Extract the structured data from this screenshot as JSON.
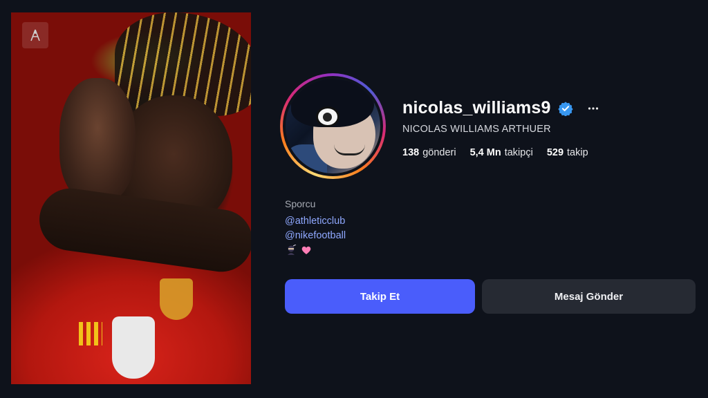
{
  "profile": {
    "username": "nicolas_williams9",
    "full_name": "NICOLAS WILLIAMS ARTHUER",
    "verified": true,
    "stats": {
      "posts_value": "138",
      "posts_label": "gönderi",
      "followers_value": "5,4 Mn",
      "followers_label": "takipçi",
      "following_value": "529",
      "following_label": "takip"
    },
    "bio": {
      "category": "Sporcu",
      "link1": "@athleticclub",
      "link2": "@nikefootball",
      "emojis": [
        "ninja-emoji",
        "pink-heart-emoji"
      ]
    }
  },
  "actions": {
    "follow_label": "Takip Et",
    "message_label": "Mesaj Gönder"
  },
  "colors": {
    "background": "#0e121b",
    "primary_button": "#4a5dfb",
    "secondary_button": "#262a33",
    "link": "#8fa8ff",
    "verified_badge": "#3897f0"
  },
  "icons": {
    "verified": "verified-badge-icon",
    "more": "more-options-icon",
    "watermark": "watermark-logo-icon"
  }
}
